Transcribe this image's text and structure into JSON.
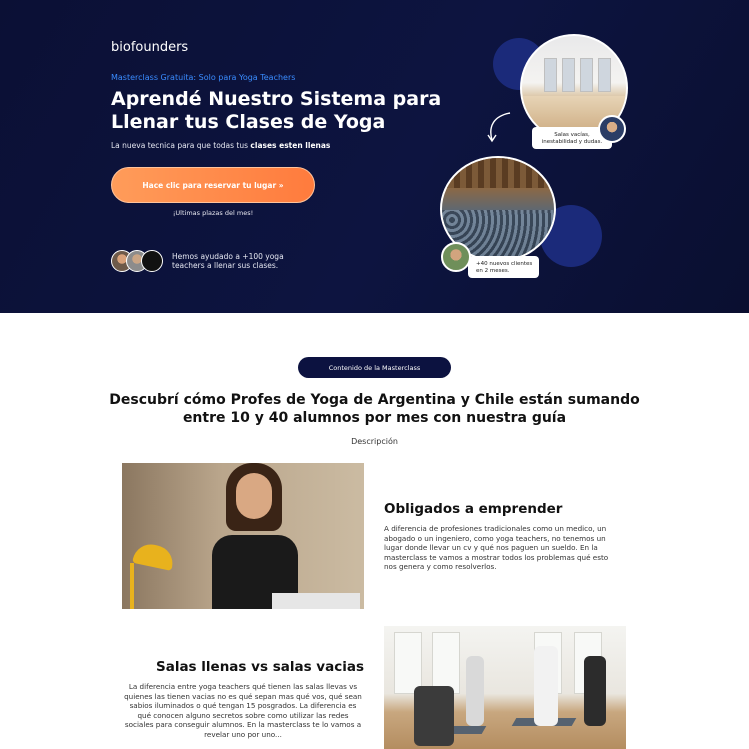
{
  "hero": {
    "logo": "biofounders",
    "eyebrow": "Masterclass Gratuita: Solo para Yoga Teachers",
    "headline_line1": "Aprendé Nuestro Sistema para",
    "headline_line2": "Llenar tus Clases de Yoga",
    "subline_prefix": "La nueva tecnica para que todas tus ",
    "subline_bold": "clases esten llenas",
    "cta_label": "Hace clic para reservar tu lugar »",
    "scarcity": "¡Ultimas plazas del mes!",
    "proof_text": "Hemos ayudado a +100 yoga teachers a llenar sus clases.",
    "tag1_line1": "Salas vacías,",
    "tag1_line2": "inestabilidad y dudas.",
    "tag2_line1": "+40 nuevos clientes",
    "tag2_line2": "en 2 meses."
  },
  "content": {
    "pill_label": "Contenido de la Masterclass",
    "title_line1": "Descubrí cómo Profes de Yoga de Argentina y Chile están sumando",
    "title_line2": "entre 10 y 40 alumnos por mes con nuestra guía",
    "description": "Descripción",
    "block1_title": "Obligados a emprender",
    "block1_text": "A diferencia de profesiones tradicionales como un medico, un abogado o un ingeniero, como yoga teachers, no tenemos un lugar donde llevar un cv y qué nos paguen un sueldo. En la masterclass te vamos a mostrar todos los problemas qué esto nos genera y como resolverlos.",
    "block2_title": "Salas llenas vs salas vacias",
    "block2_text": "La diferencia entre yoga teachers qué tienen las salas llevas vs quienes las tienen vacias no es qué sepan mas qué vos, qué sean sabios iluminados o qué tengan 15 posgrados. La diferencia es qué conocen alguno secretos sobre como utilizar las redes sociales para conseguir alumnos. En la masterclass te lo vamos a revelar uno por uno..."
  },
  "colors": {
    "hero_bg": "#0d1440",
    "accent_blue": "#1f6fff",
    "cta_orange": "#ff8a45",
    "pill_navy": "#0c1240"
  }
}
